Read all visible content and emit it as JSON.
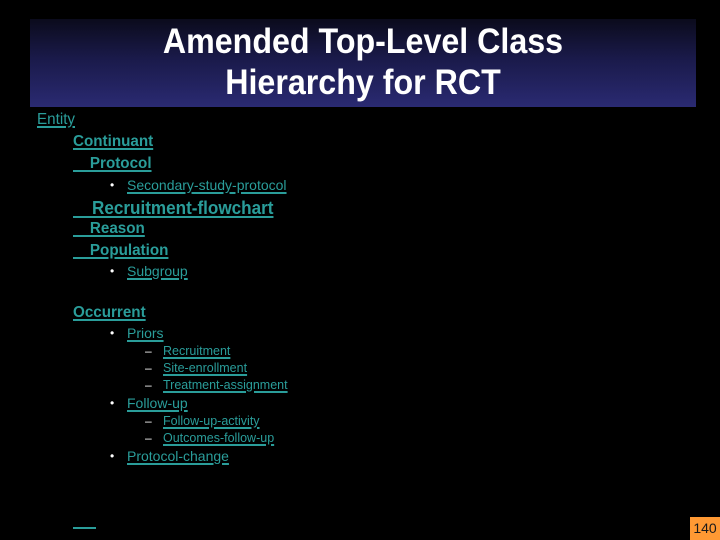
{
  "slide": {
    "title_line1": "Amended Top-Level Class",
    "title_line2": "Hierarchy for RCT",
    "page_number": "140",
    "colors": {
      "link": "#2a9d9a",
      "title_bg_top": "#0b0b1c",
      "title_bg_bottom": "#2a2a72",
      "page_number_bg": "#ff9933",
      "bullet": "#ffffff"
    }
  },
  "hierarchy": {
    "root": "Entity",
    "continuant": {
      "label": "Continuant",
      "protocol": "    Protocol",
      "secondary_study_protocol": "Secondary-study-protocol",
      "recruitment_flowchart": "    Recruitment-flowchart",
      "reason": "    Reason",
      "population": "    Population",
      "subgroup": "Subgroup"
    },
    "occurrent": {
      "label": "Occurrent",
      "priors": "Priors",
      "recruitment": "Recruitment",
      "site_enrollment": "Site-enrollment",
      "treatment_assignment": "Treatment-assignment",
      "follow_up": "Follow-up",
      "follow_up_activity": "Follow-up-activity",
      "outcomes_follow_up": "Outcomes-follow-up",
      "protocol_change": "Protocol-change"
    }
  },
  "markers": {
    "bullet": "•",
    "dash": "–"
  }
}
